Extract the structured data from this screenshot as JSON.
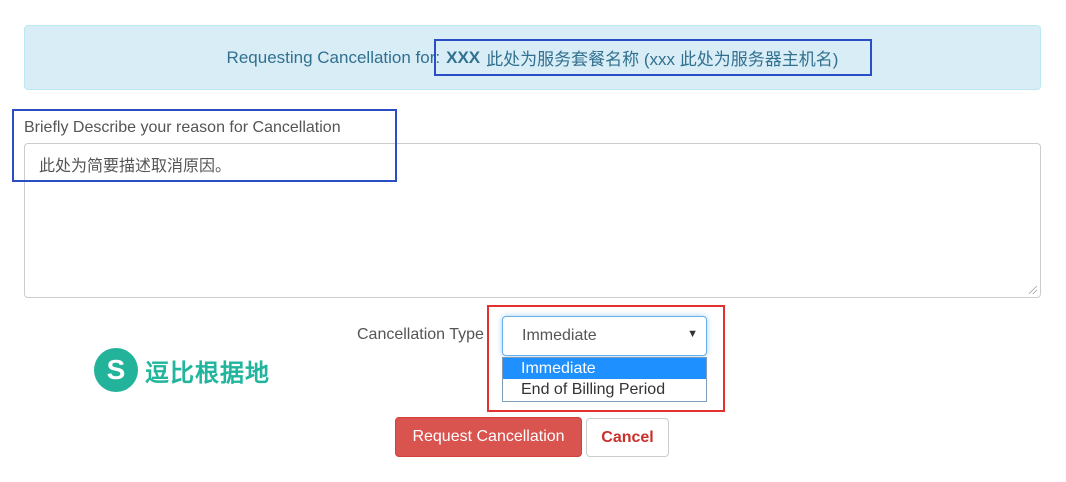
{
  "info": {
    "prefix": "Requesting Cancellation for:",
    "product_strong": "XXX",
    "product_rest": "此处为服务套餐名称 (xxx 此处为服务器主机名)"
  },
  "reason": {
    "label": "Briefly Describe your reason for Cancellation",
    "value": "此处为简要描述取消原因。"
  },
  "cancellation_type": {
    "label": "Cancellation Type",
    "selected": "Immediate",
    "options": [
      "Immediate",
      "End of Billing Period"
    ]
  },
  "watermark": {
    "text": "逗比根据地"
  },
  "buttons": {
    "request": "Request Cancellation",
    "cancel": "Cancel"
  },
  "colors": {
    "info_bg": "#d9edf7",
    "info_text": "#31708f",
    "danger": "#d9534f",
    "annotation_blue": "#2b4ec4",
    "annotation_red": "#e2312f",
    "logo_green": "#23b39b",
    "option_highlight": "#1e90ff"
  }
}
